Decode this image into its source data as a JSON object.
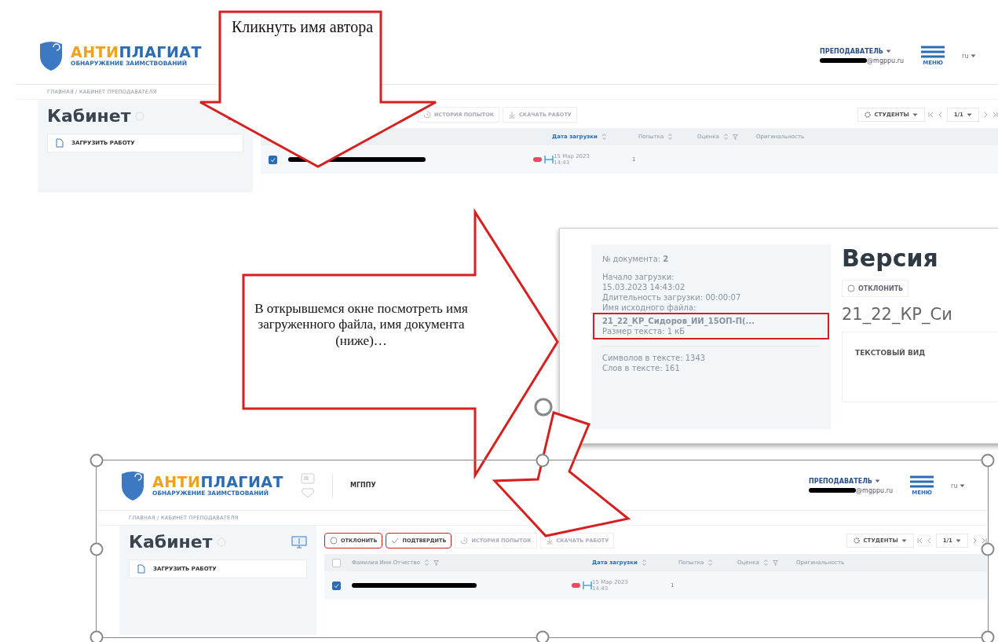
{
  "screenshots": [
    {
      "brand": [
        "АНТИ",
        "ПЛАГИАТ"
      ],
      "tagline": "ОБНАРУЖЕНИЕ ЗАИМСТВОВАНИЙ",
      "role": "ПРЕПОДАВАТЕЛЬ",
      "email": "@mgppu.ru",
      "menu": "МЕНЮ",
      "lang": "ru",
      "breadcrumb": "ГЛАВНАЯ / КАБИНЕТ ПРЕПОДАВАТЕЛЯ",
      "cabinet": "Кабинет",
      "upload": "ЗАГРУЗИТЬ РАБОТУ",
      "toolbar": [
        {
          "label": "ИСТОРИЯ ПОПЫТОК",
          "kind": "history",
          "highlighted": false
        },
        {
          "label": "СКАЧАТЬ РАБОТУ",
          "kind": "download",
          "highlighted": false
        }
      ],
      "students": "СТУДЕНТЫ",
      "pager": "1/1",
      "columns": [
        {
          "label": "Дата загрузки",
          "sorted": true,
          "sortable": true,
          "filter": false
        },
        {
          "label": "Попытка",
          "sorted": false,
          "sortable": true,
          "filter": false
        },
        {
          "label": "Оценка",
          "sorted": false,
          "sortable": true,
          "filter": true
        },
        {
          "label": "Оригинальность",
          "sorted": false,
          "sortable": false,
          "filter": false
        }
      ],
      "row": {
        "checked": true,
        "date": [
          "15 Мар 2023",
          "14:43"
        ],
        "attempt": "1"
      }
    },
    {
      "brand": [
        "АНТИ",
        "ПЛАГИАТ"
      ],
      "tagline": "ОБНАРУЖЕНИЕ ЗАИМСТВОВАНИЙ",
      "org": "МГППУ",
      "role": "ПРЕПОДАВАТЕЛЬ",
      "email": "@mgppu.ru",
      "menu": "МЕНЮ",
      "lang": "ru",
      "breadcrumb": "ГЛАВНАЯ / КАБИНЕТ ПРЕПОДАВАТЕЛЯ",
      "cabinet": "Кабинет",
      "upload": "ЗАГРУЗИТЬ РАБОТУ",
      "toolbar": [
        {
          "label": "ОТКЛОНИТЬ",
          "kind": "reject",
          "highlighted": true
        },
        {
          "label": "ПОДТВЕРДИТЬ",
          "kind": "confirm",
          "highlighted": true
        },
        {
          "label": "ИСТОРИЯ ПОПЫТОК",
          "kind": "history",
          "highlighted": false
        },
        {
          "label": "СКАЧАТЬ РАБОТУ",
          "kind": "download",
          "highlighted": false
        }
      ],
      "students": "СТУДЕНТЫ",
      "pager": "1/1",
      "name_column": "Фамилия Имя Отчество",
      "select_all": {
        "checked": false
      },
      "columns": [
        {
          "label": "Дата загрузки",
          "sorted": true,
          "sortable": true,
          "filter": false
        },
        {
          "label": "Попытка",
          "sorted": false,
          "sortable": true,
          "filter": false
        },
        {
          "label": "Оценка",
          "sorted": false,
          "sortable": true,
          "filter": true
        },
        {
          "label": "Оригинальность",
          "sorted": false,
          "sortable": false,
          "filter": false
        }
      ],
      "row": {
        "checked": true,
        "date": [
          "15 Мар 2023",
          "14:43"
        ],
        "attempt": "1"
      }
    }
  ],
  "dialog": {
    "info": [
      {
        "kind": "line",
        "text": "№ документа: **2**"
      },
      {
        "kind": "gap"
      },
      {
        "kind": "line",
        "text": "Начало загрузки:"
      },
      {
        "kind": "line",
        "text": "15.03.2023 14:43:02"
      },
      {
        "kind": "line",
        "text": "Длительность загрузки: 00:00:07"
      },
      {
        "kind": "line",
        "text": "Имя исходного файла:"
      },
      {
        "kind": "highlight",
        "lines": [
          "**21_22_КР_Сидоров_ИИ_15ОП-П(...**",
          "Размер текста: 1 кБ"
        ]
      },
      {
        "kind": "divider"
      },
      {
        "kind": "line",
        "text": "Символов в тексте: 1343"
      },
      {
        "kind": "line",
        "text": "Слов в тексте: 161"
      }
    ],
    "title": "Версия",
    "reject": "ОТКЛОНИТЬ",
    "doc_name": "21_22_КР_Си",
    "view": "ТЕКСТОВЫЙ ВИД"
  },
  "callouts": [
    {
      "kind": "down",
      "text": "Кликнуть имя автора"
    },
    {
      "kind": "right",
      "text": "В открывшемся окне посмотреть имя загруженного файла, имя документа (ниже)…"
    }
  ]
}
